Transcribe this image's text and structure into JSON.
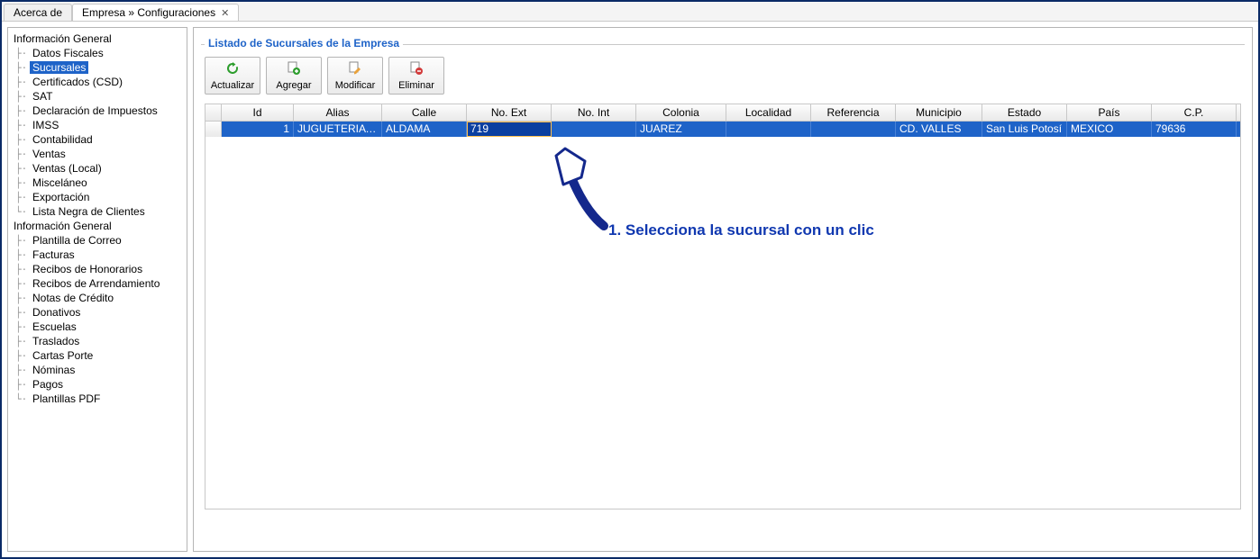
{
  "tabs": {
    "tab1": "Acerca de",
    "tab2": "Empresa » Configuraciones"
  },
  "sidebar": {
    "group1_label": "Información General",
    "group1_items": [
      "Datos Fiscales",
      "Sucursales",
      "Certificados (CSD)",
      "SAT",
      "Declaración de Impuestos",
      "IMSS",
      "Contabilidad",
      "Ventas",
      "Ventas (Local)",
      "Misceláneo",
      "Exportación",
      "Lista Negra de Clientes"
    ],
    "group2_label": "Información General",
    "group2_items": [
      "Plantilla de Correo",
      "Facturas",
      "Recibos de Honorarios",
      "Recibos de Arrendamiento",
      "Notas de Crédito",
      "Donativos",
      "Escuelas",
      "Traslados",
      "Cartas Porte",
      "Nóminas",
      "Pagos",
      "Plantillas PDF"
    ],
    "selected": "Sucursales"
  },
  "main": {
    "group_title": "Listado de Sucursales de la Empresa",
    "buttons": {
      "refresh": "Actualizar",
      "add": "Agregar",
      "edit": "Modificar",
      "delete": "Eliminar"
    },
    "columns": {
      "id": "Id",
      "alias": "Alias",
      "calle": "Calle",
      "noext": "No. Ext",
      "noint": "No. Int",
      "colonia": "Colonia",
      "localidad": "Localidad",
      "referencia": "Referencia",
      "municipio": "Municipio",
      "estado": "Estado",
      "pais": "País",
      "cp": "C.P."
    },
    "row": {
      "id": "1",
      "alias": "JUGUETERIA LA…",
      "calle": "ALDAMA",
      "noext": "719",
      "noint": "",
      "colonia": "JUAREZ",
      "localidad": "",
      "referencia": "",
      "municipio": "CD. VALLES",
      "estado": "San Luis Potosí",
      "pais": "MEXICO",
      "cp": "79636"
    }
  },
  "annotation": {
    "text": "1. Selecciona  la sucursal con un clic"
  }
}
